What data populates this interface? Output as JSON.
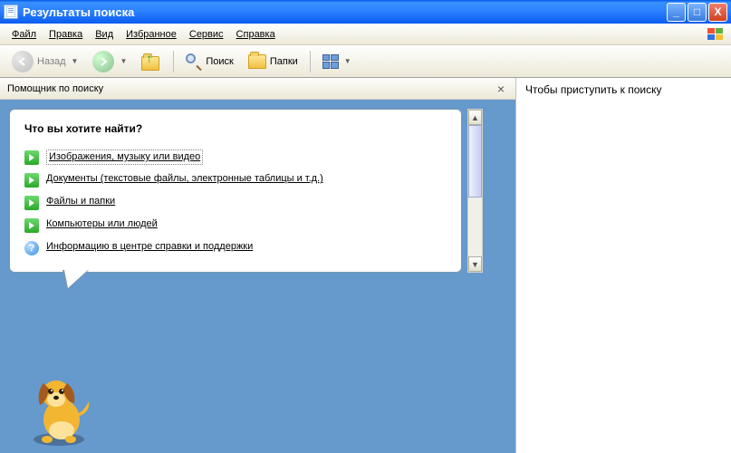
{
  "window": {
    "title": "Результаты поиска",
    "min": "_",
    "max": "□",
    "close": "X"
  },
  "menu": {
    "file": "Файл",
    "edit": "Правка",
    "view": "Вид",
    "favorites": "Избранное",
    "tools": "Сервис",
    "help": "Справка"
  },
  "toolbar": {
    "back": "Назад",
    "search": "Поиск",
    "folders": "Папки"
  },
  "pane": {
    "title": "Помощник по поиску",
    "close": "×"
  },
  "balloon": {
    "heading": "Что вы хотите найти?",
    "opt1": "Изображения, музыку или видео",
    "opt2": "Документы (текстовые файлы, электронные таблицы и т.д.)",
    "opt3": "Файлы и папки",
    "opt4": "Компьютеры или людей",
    "opt5": "Информацию в центре справки и поддержки"
  },
  "right": {
    "hint": "Чтобы приступить к поиску"
  }
}
